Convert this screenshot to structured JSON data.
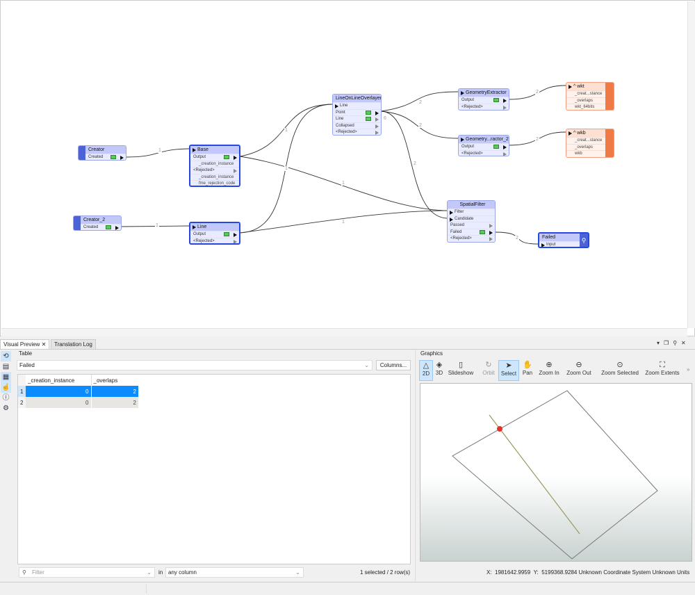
{
  "canvas": {
    "nodes": {
      "creator": {
        "title": "Creator",
        "ports": [
          "Created"
        ]
      },
      "creator2": {
        "title": "Creator_2",
        "ports": [
          "Created"
        ]
      },
      "base": {
        "title": "Base",
        "rows": [
          "Output",
          "_creation_instance",
          "<Rejected>",
          "_creation_instance",
          "fme_rejection_code"
        ]
      },
      "line": {
        "title": "Line",
        "rows": [
          "Output",
          "<Rejected>"
        ]
      },
      "lolo": {
        "title": "LineOnLineOverlayer",
        "rows": [
          "Line",
          "Point",
          "Line",
          "Collapsed",
          "<Rejected>"
        ]
      },
      "ge": {
        "title": "GeometryExtractor",
        "rows": [
          "Output",
          "<Rejected>"
        ]
      },
      "ge2": {
        "title": "Geometry...ractor_2",
        "rows": [
          "Output",
          "<Rejected>"
        ]
      },
      "wkt": {
        "title": "^ wkt",
        "rows": [
          "_creat...stance",
          "_overlaps",
          "wkt_64bits"
        ]
      },
      "wkb": {
        "title": "^ wkb",
        "rows": [
          "_creat...stance",
          "_overlaps",
          "wkb"
        ]
      },
      "sf": {
        "title": "SpatialFilter",
        "rows": [
          "Filter",
          "Candidate",
          "Passed",
          "Failed",
          "<Rejected>"
        ]
      },
      "failed": {
        "title": "Failed",
        "rows": [
          "Input"
        ]
      }
    },
    "link_counts": {
      "c1": "1",
      "c2": "1",
      "b_lolo": "1",
      "l_lolo": "1",
      "p_ge": "2",
      "p_ge2": "2",
      "line6": "6",
      "p_sf": "2",
      "b_sf": "1",
      "l_sf": "1",
      "ge_wkt": "2",
      "ge2_wkb": "2",
      "sf_failed": "2"
    }
  },
  "tabs": [
    "Visual Preview",
    "Translation Log"
  ],
  "table": {
    "group_label": "Table",
    "selected": "Failed",
    "columns_btn": "Columns...",
    "headers": [
      "_creation_instance",
      "_overlaps"
    ],
    "rows": [
      [
        "1",
        "0",
        "2"
      ],
      [
        "2",
        "0",
        "2"
      ]
    ],
    "filter_placeholder": "Filter",
    "in_label": "in",
    "column_select": "any column",
    "status": "1 selected / 2 row(s)"
  },
  "graphics": {
    "group_label": "Graphics",
    "tools": [
      "2D",
      "3D",
      "Slideshow",
      "Orbit",
      "Select",
      "Pan",
      "Zoom In",
      "Zoom Out",
      "Zoom Selected",
      "Zoom Extents"
    ],
    "x_label": "X:",
    "x": "1981642.9959",
    "y_label": "Y:",
    "y": "5199368.9284",
    "crs": "Unknown Coordinate System",
    "units": "Unknown Units"
  },
  "colors": {
    "accent": "#2846e0",
    "selected_row": "#0a8cff",
    "writer": "#f07a45"
  }
}
